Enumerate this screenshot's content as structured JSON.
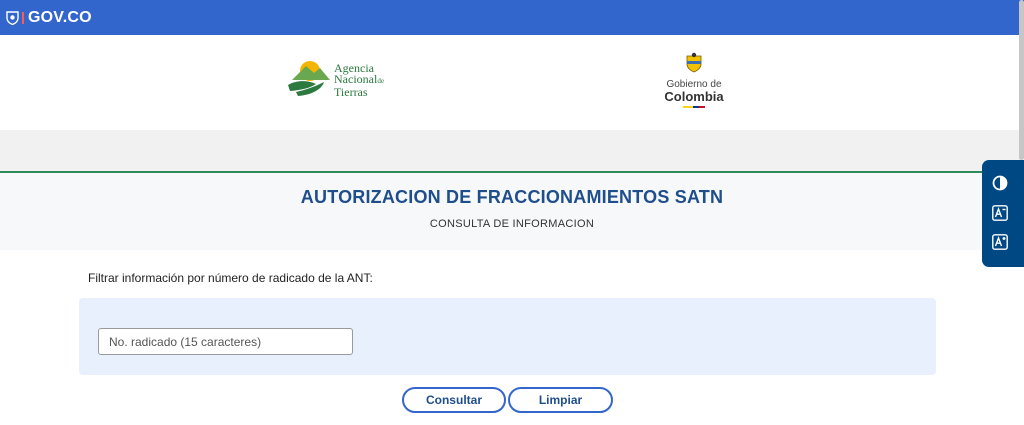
{
  "topbar": {
    "brand": "GOV.CO",
    "shield_icon": "colombia-shield-icon"
  },
  "header": {
    "ant_logo": {
      "line1": "Agencia",
      "line2": "Nacional",
      "line2_suffix": "de",
      "line3": "Tierras"
    },
    "gov_logo": {
      "line1": "Gobierno de",
      "line2": "Colombia",
      "flag_colors": [
        "#f9d616",
        "#003893",
        "#ce1126"
      ]
    }
  },
  "title_section": {
    "title": "AUTORIZACION DE FRACCIONAMIENTOS SATN",
    "subtitle": "CONSULTA DE INFORMACION"
  },
  "filter": {
    "label": "Filtrar información por número de radicado de la ANT:",
    "input_placeholder": "No. radicado (15 caracteres)",
    "input_value": ""
  },
  "actions": {
    "consultar": "Consultar",
    "limpiar": "Limpiar"
  },
  "accessibility": {
    "items": [
      {
        "name": "contrast-icon"
      },
      {
        "name": "decrease-font-icon"
      },
      {
        "name": "increase-font-icon"
      }
    ]
  },
  "colors": {
    "topbar": "#3366cc",
    "title": "#1f4e8c",
    "accessibility_bar": "#004884",
    "accent_line": "#2f8a5b"
  }
}
